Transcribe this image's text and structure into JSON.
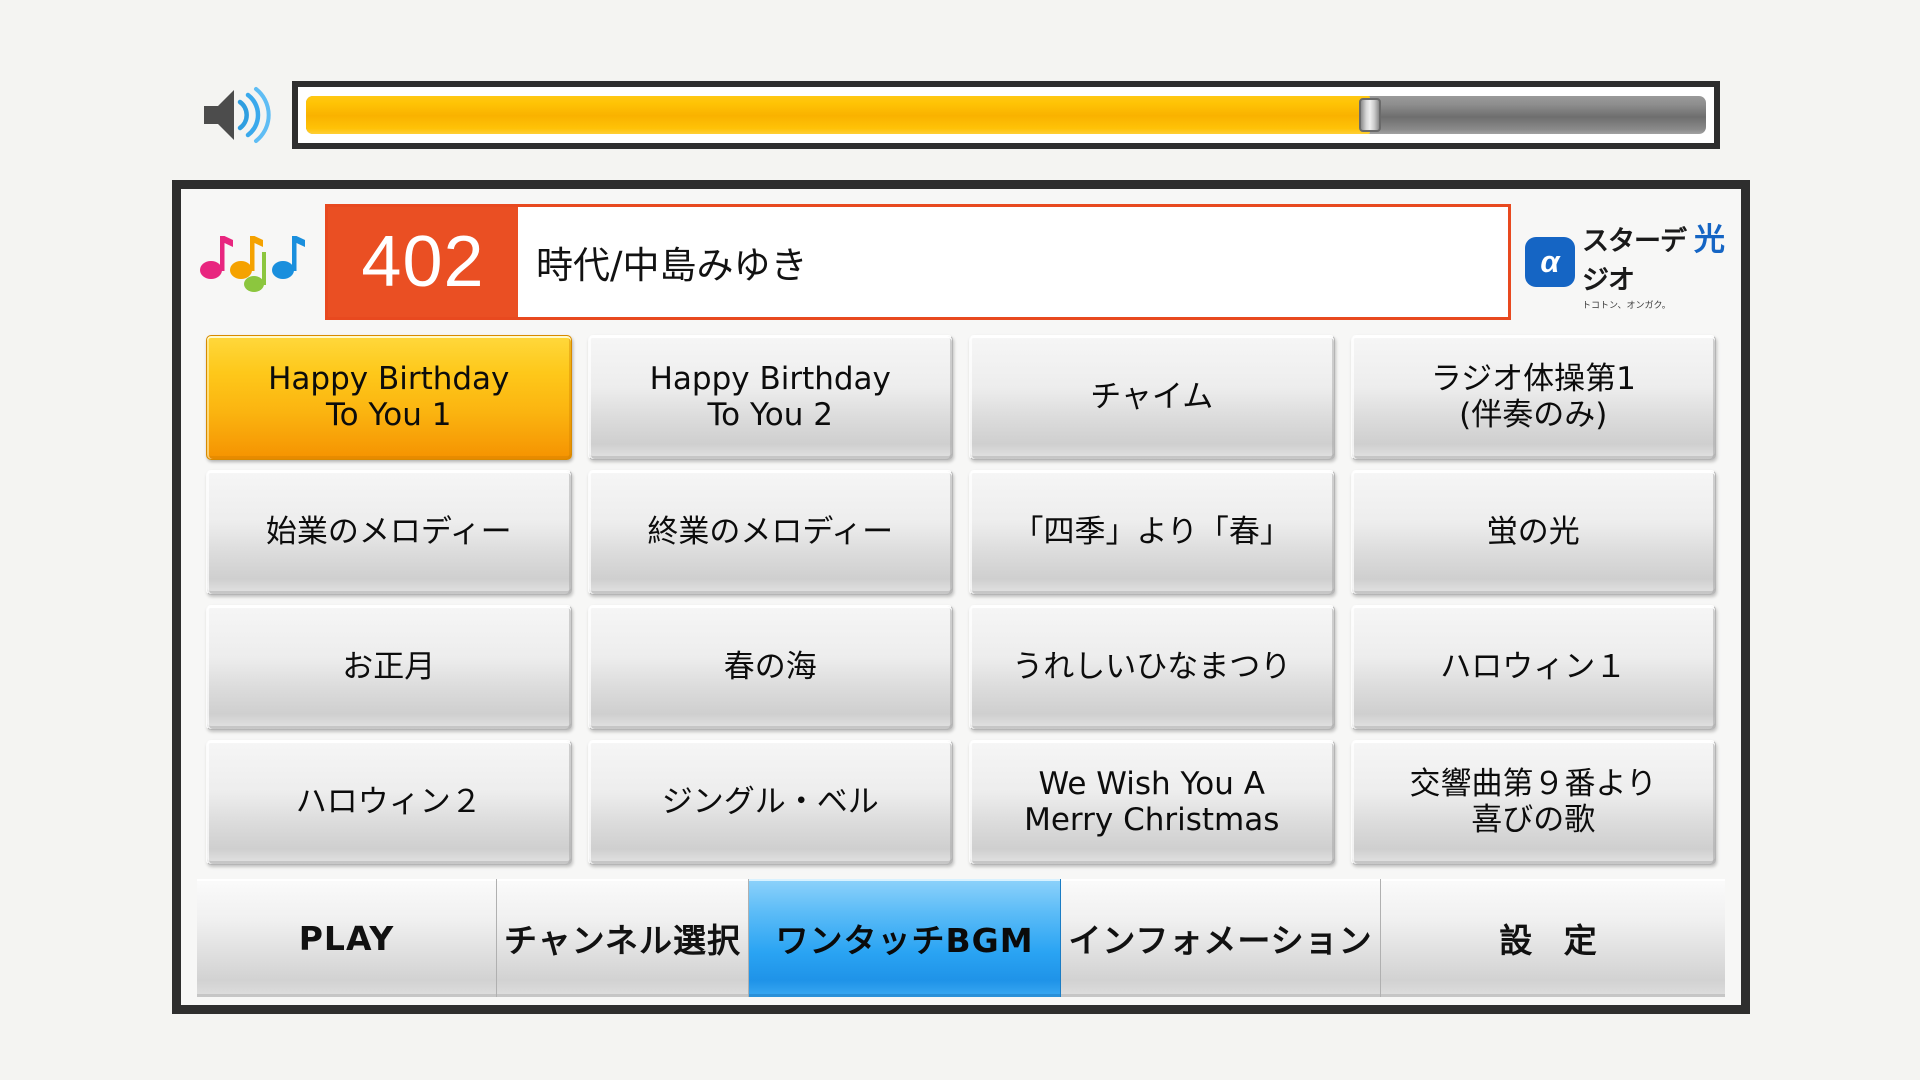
{
  "volume": {
    "speaker_icon": "speaker-wave-icon",
    "level_percent": 76,
    "fill_color": "#f9b200",
    "track_color": "#7c7c7c"
  },
  "now_playing": {
    "notes_icon": "music-notes-icon",
    "note_colors": [
      "#e8267f",
      "#f5a200",
      "#8cc63e",
      "#1a8fdd"
    ],
    "number": "402",
    "number_bg": "#ea4f23",
    "title": "時代/中島みゆき",
    "brand": {
      "badge_glyph": "α",
      "badge_color": "#1565c4",
      "name": "スターデジオ",
      "hikari": "光",
      "tagline": "トコトン、オンガク。"
    }
  },
  "bgm_buttons": [
    {
      "lines": [
        "Happy Birthday",
        "To You 1"
      ],
      "selected": true
    },
    {
      "lines": [
        "Happy Birthday",
        "To You 2"
      ],
      "selected": false
    },
    {
      "lines": [
        "チャイム"
      ],
      "selected": false
    },
    {
      "lines": [
        "ラジオ体操第1",
        "(伴奏のみ)"
      ],
      "selected": false
    },
    {
      "lines": [
        "始業のメロディー"
      ],
      "selected": false
    },
    {
      "lines": [
        "終業のメロディー"
      ],
      "selected": false
    },
    {
      "lines": [
        "「四季」より「春」"
      ],
      "selected": false
    },
    {
      "lines": [
        "蛍の光"
      ],
      "selected": false
    },
    {
      "lines": [
        "お正月"
      ],
      "selected": false
    },
    {
      "lines": [
        "春の海"
      ],
      "selected": false
    },
    {
      "lines": [
        "うれしいひなまつり"
      ],
      "selected": false
    },
    {
      "lines": [
        "ハロウィン１"
      ],
      "selected": false
    },
    {
      "lines": [
        "ハロウィン２"
      ],
      "selected": false
    },
    {
      "lines": [
        "ジングル・ベル"
      ],
      "selected": false
    },
    {
      "lines": [
        "We Wish You A",
        "Merry Christmas"
      ],
      "selected": false
    },
    {
      "lines": [
        "交響曲第９番より",
        "喜びの歌"
      ],
      "selected": false
    }
  ],
  "tabs": {
    "play": "PLAY",
    "channel": "チャンネル選択",
    "bgm": "ワンタッチBGM",
    "info": "インフォメーション",
    "settings": "設 定",
    "active": "bgm",
    "active_color": "#2aa4f3"
  }
}
